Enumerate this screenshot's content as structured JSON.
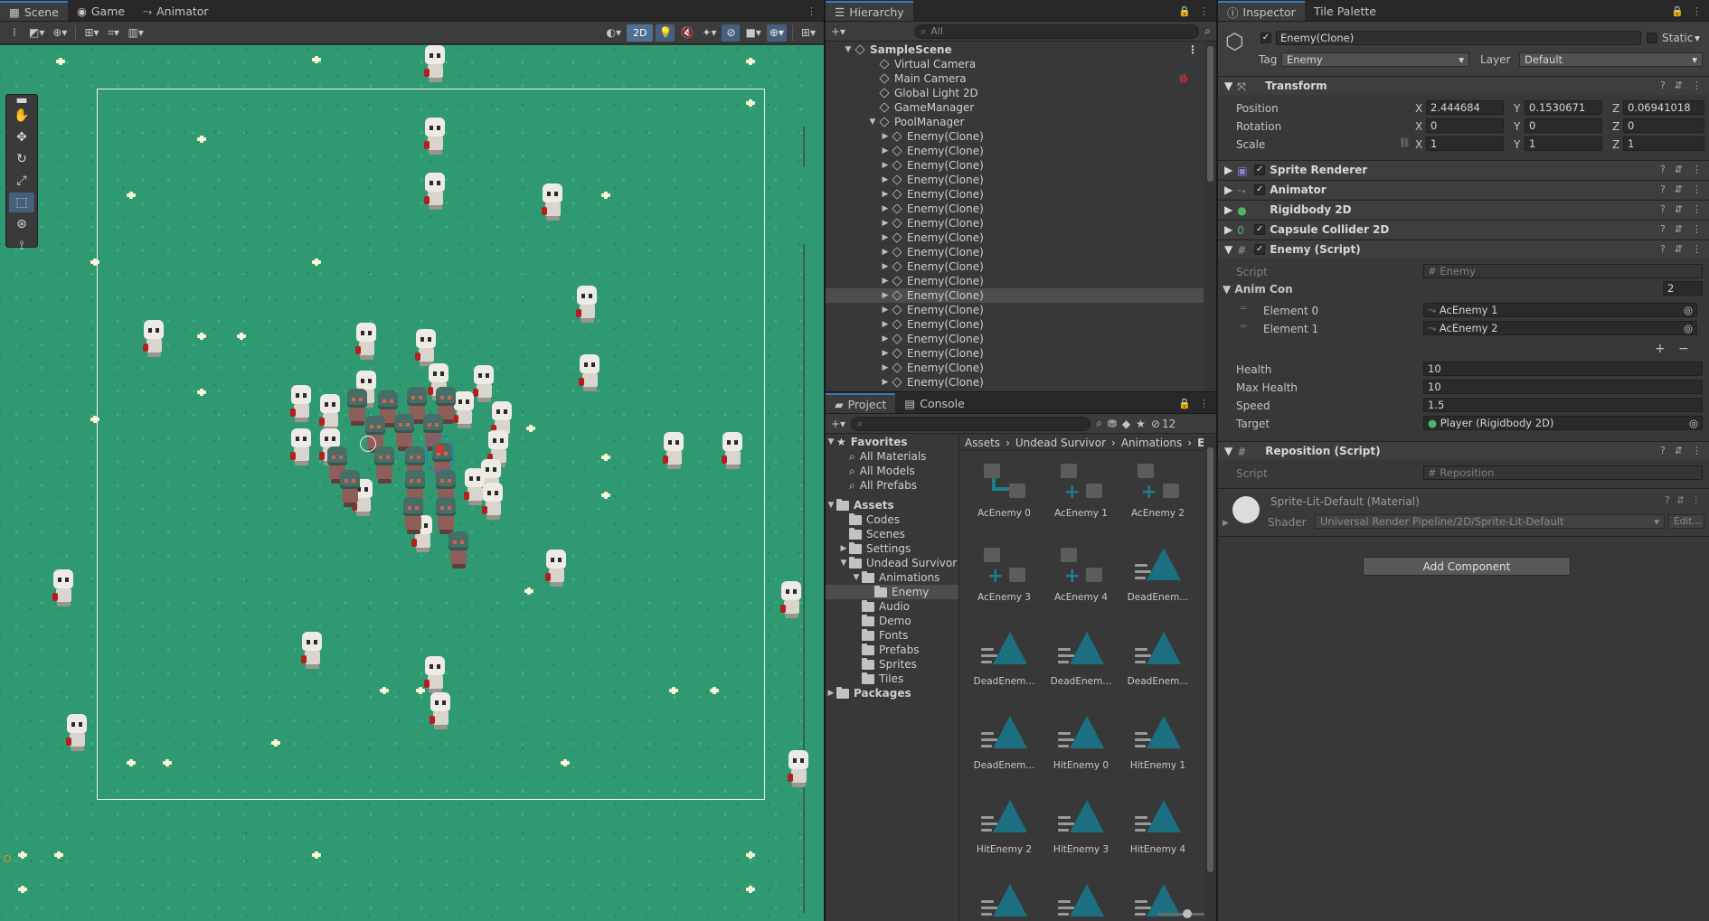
{
  "scene": {
    "tabs": [
      "Scene",
      "Game",
      "Animator"
    ],
    "toolbar": {
      "mode_2d": "2D"
    }
  },
  "hierarchy": {
    "tab": "Hierarchy",
    "search_placeholder": "All",
    "scene_name": "SampleScene",
    "items": [
      "Virtual Camera",
      "Main Camera",
      "Global Light 2D",
      "GameManager",
      "PoolManager"
    ],
    "pool_children": [
      "Enemy(Clone)",
      "Enemy(Clone)",
      "Enemy(Clone)",
      "Enemy(Clone)",
      "Enemy(Clone)",
      "Enemy(Clone)",
      "Enemy(Clone)",
      "Enemy(Clone)",
      "Enemy(Clone)",
      "Enemy(Clone)",
      "Enemy(Clone)",
      "Enemy(Clone)",
      "Enemy(Clone)",
      "Enemy(Clone)",
      "Enemy(Clone)",
      "Enemy(Clone)",
      "Enemy(Clone)",
      "Enemy(Clone)"
    ],
    "selected_index": 11
  },
  "project": {
    "tabs": [
      "Project",
      "Console"
    ],
    "hidden_count": "12",
    "favorites_label": "Favorites",
    "favorites": [
      "All Materials",
      "All Models",
      "All Prefabs"
    ],
    "assets_label": "Assets",
    "assets_children": [
      "Codes",
      "Scenes",
      "Settings",
      "Undead Survivor"
    ],
    "undead_children": [
      "Animations",
      "Enemy",
      "Audio",
      "Demo",
      "Fonts",
      "Prefabs",
      "Sprites",
      "Tiles"
    ],
    "packages_label": "Packages",
    "breadcrumb": [
      "Assets",
      "Undead Survivor",
      "Animations",
      "Enemy"
    ],
    "grid": [
      {
        "label": "AcEnemy 0",
        "kind": "controller"
      },
      {
        "label": "AcEnemy 1",
        "kind": "override"
      },
      {
        "label": "AcEnemy 2",
        "kind": "override"
      },
      {
        "label": "AcEnemy 3",
        "kind": "override"
      },
      {
        "label": "AcEnemy 4",
        "kind": "override"
      },
      {
        "label": "DeadEnem...",
        "kind": "anim"
      },
      {
        "label": "DeadEnem...",
        "kind": "anim"
      },
      {
        "label": "DeadEnem...",
        "kind": "anim"
      },
      {
        "label": "DeadEnem...",
        "kind": "anim"
      },
      {
        "label": "DeadEnem...",
        "kind": "anim"
      },
      {
        "label": "HitEnemy 0",
        "kind": "anim"
      },
      {
        "label": "HitEnemy 1",
        "kind": "anim"
      },
      {
        "label": "HitEnemy 2",
        "kind": "anim"
      },
      {
        "label": "HitEnemy 3",
        "kind": "anim"
      },
      {
        "label": "HitEnemy 4",
        "kind": "anim"
      }
    ]
  },
  "inspector": {
    "tabs": [
      "Inspector",
      "Tile Palette"
    ],
    "object_name": "Enemy(Clone)",
    "static_label": "Static",
    "tag_label": "Tag",
    "tag_value": "Enemy",
    "layer_label": "Layer",
    "layer_value": "Default",
    "transform": {
      "title": "Transform",
      "position_label": "Position",
      "position": {
        "x": "2.444684",
        "y": "0.1530671",
        "z": "0.06941018"
      },
      "rotation_label": "Rotation",
      "rotation": {
        "x": "0",
        "y": "0",
        "z": "0"
      },
      "scale_label": "Scale",
      "scale": {
        "x": "1",
        "y": "1",
        "z": "1"
      }
    },
    "components": [
      "Sprite Renderer",
      "Animator",
      "Rigidbody 2D",
      "Capsule Collider 2D",
      "Enemy (Script)"
    ],
    "enemy_script": {
      "script_label": "Script",
      "script_value": "Enemy",
      "anim_con_label": "Anim Con",
      "anim_con_count": "2",
      "elements": [
        {
          "label": "Element 0",
          "value": "AcEnemy 1"
        },
        {
          "label": "Element 1",
          "value": "AcEnemy 2"
        }
      ],
      "health_label": "Health",
      "health": "10",
      "max_health_label": "Max Health",
      "max_health": "10",
      "speed_label": "Speed",
      "speed": "1.5",
      "target_label": "Target",
      "target": "Player (Rigidbody 2D)"
    },
    "reposition": {
      "title": "Reposition (Script)",
      "script_label": "Script",
      "script_value": "Reposition"
    },
    "material": {
      "name": "Sprite-Lit-Default (Material)",
      "shader_label": "Shader",
      "shader_value": "Universal Render Pipeline/2D/Sprite-Lit-Default",
      "edit_label": "Edit..."
    },
    "add_component": "Add Component",
    "axis": {
      "x": "X",
      "y": "Y",
      "z": "Z"
    }
  },
  "colors": {
    "scene_bg": "#2f9a72",
    "accent": "#3a79bb",
    "selection": "#4d4d4d",
    "asset_icon": "#1b6f80"
  }
}
